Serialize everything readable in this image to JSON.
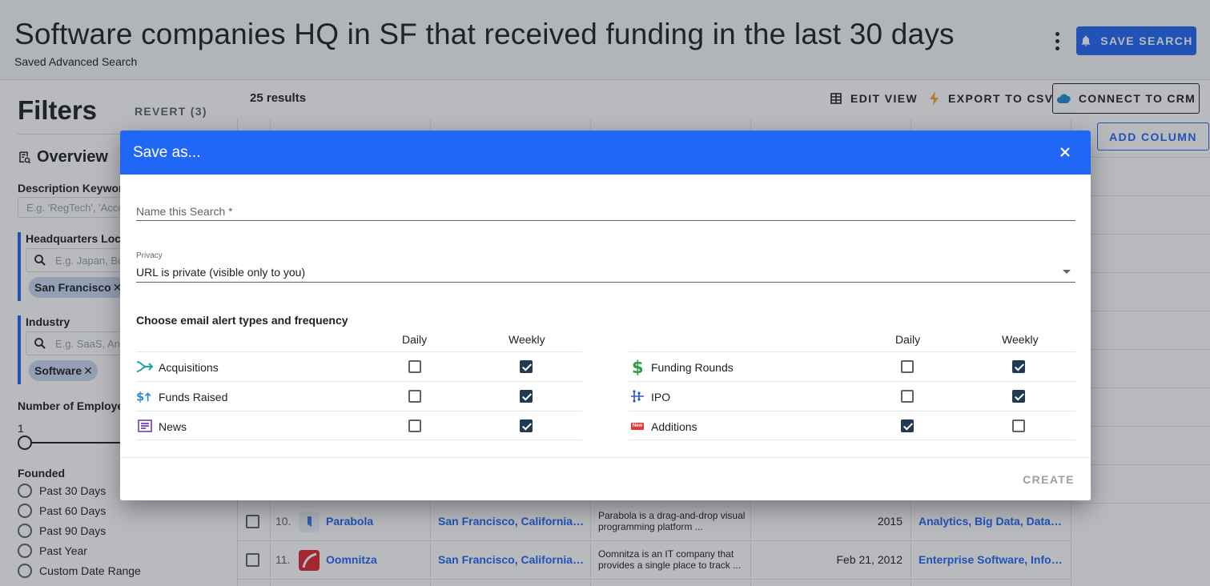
{
  "header": {
    "title": "Software companies HQ in SF that received funding in the last 30 days",
    "subtitle": "Saved Advanced Search",
    "save_search_label": "SAVE SEARCH"
  },
  "filters": {
    "title": "Filters",
    "revert_label": "REVERT (3)",
    "overview_label": "Overview",
    "description_label": "Description Keywords",
    "description_placeholder": "E.g. 'RegTech', 'Accounting'",
    "hq_label": "Headquarters Location",
    "hq_placeholder": "E.g. Japan, Boston",
    "hq_chip": "San Francisco",
    "industry_label": "Industry",
    "industry_placeholder": "E.g. SaaS, Analytics",
    "industry_chip": "Software",
    "employees_label": "Number of Employees",
    "employees_min": "1",
    "founded_label": "Founded",
    "founded_options": [
      "Past 30 Days",
      "Past 60 Days",
      "Past 90 Days",
      "Past Year",
      "Custom Date Range"
    ]
  },
  "results": {
    "count_label": "25 results",
    "edit_view_label": "EDIT VIEW",
    "export_label": "EXPORT TO CSV",
    "crm_label": "CONNECT TO CRM",
    "add_column_label": "ADD COLUMN",
    "rows": [
      {
        "num": "10.",
        "name": "Parabola",
        "location": "San Francisco, California, United States",
        "description": "Parabola is a drag-and-drop visual programming platform ...",
        "date": "2015",
        "industries": "Analytics, Big Data, Data Integration"
      },
      {
        "num": "11.",
        "name": "Oomnitza",
        "location": "San Francisco, California, United States",
        "description": "Oomnitza is an IT company that provides a single place to track ...",
        "date": "Feb 21, 2012",
        "industries": "Enterprise Software, Information Technology"
      }
    ]
  },
  "dialog": {
    "title": "Save as...",
    "name_label": "Name this Search *",
    "privacy_label": "Privacy",
    "privacy_value": "URL is private (visible only to you)",
    "alerts_title": "Choose email alert types and frequency",
    "col_daily": "Daily",
    "col_weekly": "Weekly",
    "alerts_left": [
      {
        "label": "Acquisitions",
        "icon": "acquisitions-icon",
        "daily": false,
        "weekly": true
      },
      {
        "label": "Funds Raised",
        "icon": "funds-raised-icon",
        "daily": false,
        "weekly": true
      },
      {
        "label": "News",
        "icon": "news-icon",
        "daily": false,
        "weekly": true
      }
    ],
    "alerts_right": [
      {
        "label": "Funding Rounds",
        "icon": "funding-rounds-icon",
        "daily": false,
        "weekly": true
      },
      {
        "label": "IPO",
        "icon": "ipo-icon",
        "daily": false,
        "weekly": true
      },
      {
        "label": "Additions",
        "icon": "new-badge-icon",
        "daily": true,
        "weekly": false
      }
    ],
    "new_badge": "New",
    "create_label": "CREATE"
  },
  "colors": {
    "primary": "#2167f5",
    "checked": "#1f3a52",
    "chip": "#c9d8ee"
  }
}
